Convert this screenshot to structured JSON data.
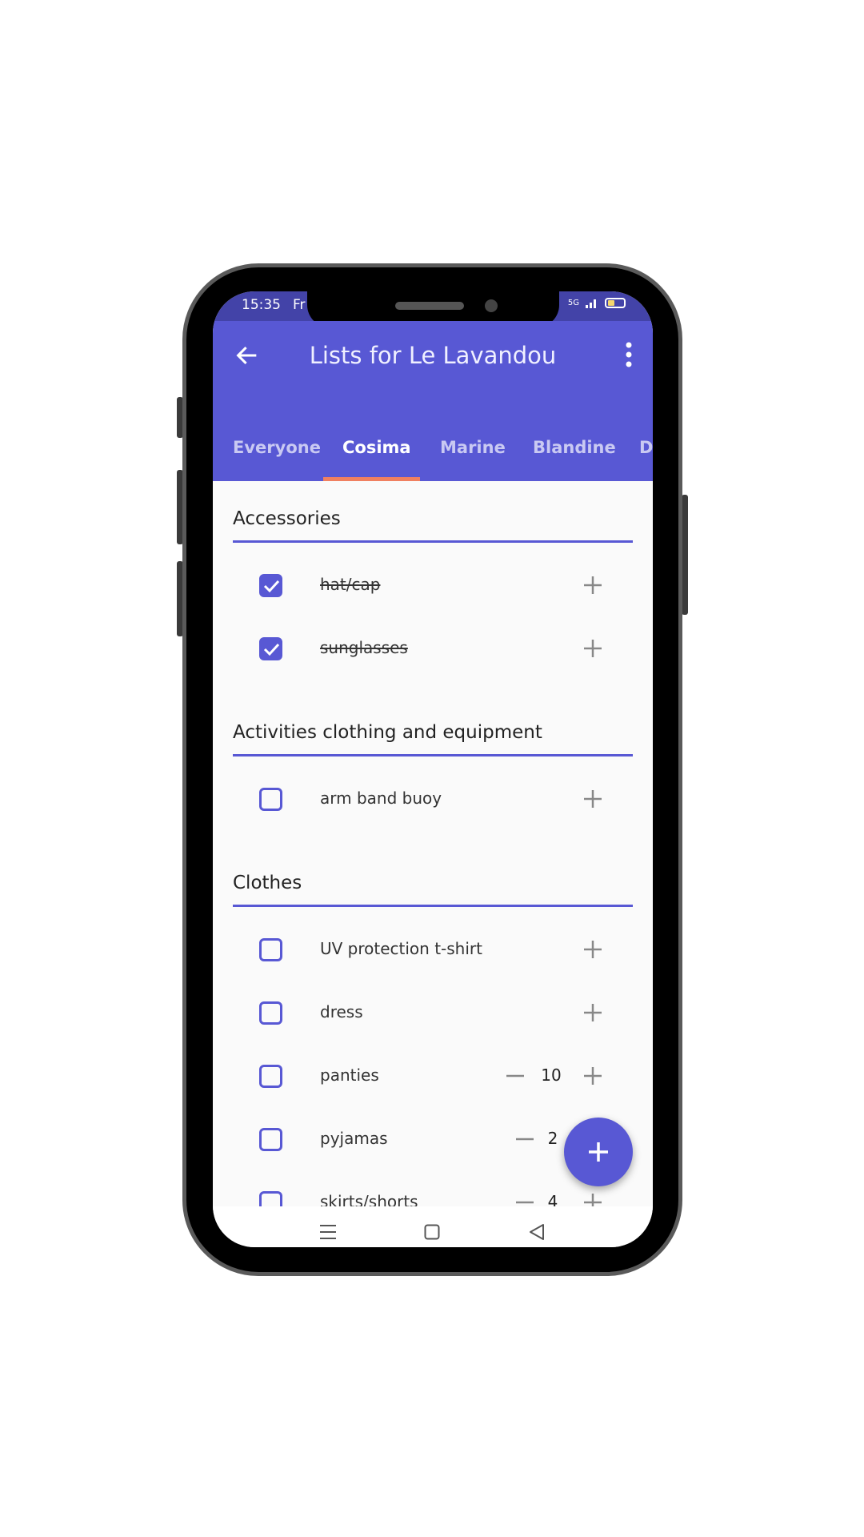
{
  "status_bar": {
    "time": "15:35",
    "extra": "Fr",
    "network": "5G"
  },
  "app_bar": {
    "title": "Lists for Le Lavandou",
    "back_icon": "arrow-left-icon",
    "menu_icon": "more-vert-icon"
  },
  "tabs": [
    {
      "label": "Everyone",
      "active": false
    },
    {
      "label": "Cosima",
      "active": true
    },
    {
      "label": "Marine",
      "active": false
    },
    {
      "label": "Blandine",
      "active": false
    },
    {
      "label": "Da",
      "active": false
    }
  ],
  "sections": [
    {
      "title": "Accessories",
      "items": [
        {
          "label": "hat/cap",
          "checked": true
        },
        {
          "label": "sunglasses",
          "checked": true
        }
      ]
    },
    {
      "title": "Activities clothing and equipment",
      "items": [
        {
          "label": "arm band buoy",
          "checked": false
        }
      ]
    },
    {
      "title": "Clothes",
      "items": [
        {
          "label": "UV protection t-shirt",
          "checked": false
        },
        {
          "label": "dress",
          "checked": false
        },
        {
          "label": "panties",
          "checked": false,
          "count": "10"
        },
        {
          "label": "pyjamas",
          "checked": false,
          "count": "2"
        },
        {
          "label": "skirts/shorts",
          "checked": false,
          "count": "4"
        }
      ]
    }
  ],
  "fab": {
    "icon": "plus-icon"
  },
  "colors": {
    "primary": "#5858d4",
    "status_bar": "#4343a8",
    "tab_indicator": "#f08060",
    "background": "#fafafa"
  }
}
